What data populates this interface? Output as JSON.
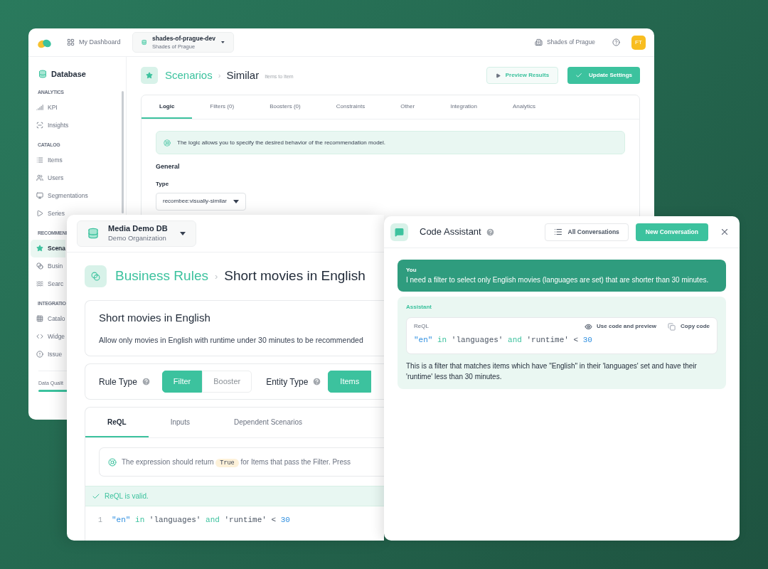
{
  "back_window": {
    "header": {
      "dashboard_link": "My Dashboard",
      "database": {
        "name": "shades-of-prague-dev",
        "organization": "Shades of Prague"
      },
      "organization": "Shades of Prague",
      "avatar": "FT"
    },
    "sidebar": {
      "title": "Database",
      "sections": [
        {
          "heading": "ANALYTICS",
          "items": [
            {
              "label": "KPI",
              "selected": false
            },
            {
              "label": "Insights",
              "selected": false
            }
          ]
        },
        {
          "heading": "CATALOG",
          "items": [
            {
              "label": "Items",
              "selected": false
            },
            {
              "label": "Users",
              "selected": false
            },
            {
              "label": "Segmentations",
              "selected": false
            },
            {
              "label": "Series",
              "selected": false
            }
          ]
        },
        {
          "heading": "RECOMMENI",
          "items": [
            {
              "label": "Scena",
              "selected": true
            },
            {
              "label": "Busin",
              "selected": false
            },
            {
              "label": "Searc",
              "selected": false
            }
          ]
        },
        {
          "heading": "INTEGRATIO",
          "items": [
            {
              "label": "Catalo",
              "selected": false
            },
            {
              "label": "Widge",
              "selected": false
            },
            {
              "label": "Issue",
              "selected": false
            }
          ]
        }
      ],
      "footer": "Data Qualit"
    },
    "page": {
      "breadcrumb": "Scenarios",
      "separator": "›",
      "title": "Similar",
      "subtitle": "Items to Item",
      "preview_button": "Preview Results",
      "update_button": "Update Settings",
      "tabs": [
        {
          "label": "Logic",
          "selected": true
        },
        {
          "label": "Filters (0)",
          "selected": false
        },
        {
          "label": "Boosters (0)",
          "selected": false
        },
        {
          "label": "Constraints",
          "selected": false
        },
        {
          "label": "Other",
          "selected": false
        },
        {
          "label": "Integration",
          "selected": false
        },
        {
          "label": "Analytics",
          "selected": false
        }
      ],
      "info": "The logic allows you to specify the desired behavior of the recommendation model.",
      "section": "General",
      "type_label": "Type",
      "type_value": "recombee:visually-similar"
    }
  },
  "front_window": {
    "database": {
      "name": "Media Demo DB",
      "organization": "Demo Organization"
    },
    "breadcrumb": "Business Rules",
    "separator": "›",
    "title": "Short movies in English",
    "card": {
      "title": "Short movies in English",
      "description": "Allow only movies in English with runtime under 30 minutes to be recommended"
    },
    "rule_type": {
      "label": "Rule Type",
      "options": [
        {
          "label": "Filter",
          "selected": true
        },
        {
          "label": "Booster",
          "selected": false
        }
      ]
    },
    "entity_type": {
      "label": "Entity Type",
      "options": [
        {
          "label": "Items",
          "selected": true
        }
      ]
    },
    "tabs": [
      {
        "label": "ReQL",
        "selected": true
      },
      {
        "label": "Inputs",
        "selected": false
      },
      {
        "label": "Dependent Scenarios",
        "selected": false
      }
    ],
    "hint": {
      "before": "The expression should return",
      "code": "True",
      "after": "for Items that pass the Filter. Press"
    },
    "validation": "ReQL is valid.",
    "code_lines": [
      {
        "number": "1",
        "tokens": [
          {
            "kind": "string",
            "text": "\"en\""
          },
          {
            "kind": "keyword",
            "text": "in"
          },
          {
            "kind": "plain",
            "text": "'languages'"
          },
          {
            "kind": "keyword",
            "text": "and"
          },
          {
            "kind": "plain",
            "text": "'runtime'"
          },
          {
            "kind": "plain",
            "text": "<"
          },
          {
            "kind": "number",
            "text": "30"
          }
        ]
      }
    ]
  },
  "assistant_window": {
    "title": "Code Assistant",
    "all_button": "All Conversations",
    "new_button": "New Conversation",
    "messages": [
      {
        "kind": "user",
        "author": "You",
        "text": "I need a filter to select only English movies (languages are set) that are shorter than 30 minutes."
      },
      {
        "kind": "assistant",
        "author": "Assistant",
        "code": {
          "language": "ReQL",
          "use_action": "Use code and preview",
          "copy_action": "Copy code",
          "tokens": [
            {
              "kind": "string",
              "text": "\"en\""
            },
            {
              "kind": "keyword",
              "text": "in"
            },
            {
              "kind": "plain",
              "text": "'languages'"
            },
            {
              "kind": "keyword",
              "text": "and"
            },
            {
              "kind": "plain",
              "text": "'runtime'"
            },
            {
              "kind": "plain",
              "text": "<"
            },
            {
              "kind": "number",
              "text": "30"
            }
          ]
        },
        "text": "This is a filter that matches items which have \"English\" in their 'languages' set and have their 'runtime' less than 30 minutes."
      }
    ]
  }
}
